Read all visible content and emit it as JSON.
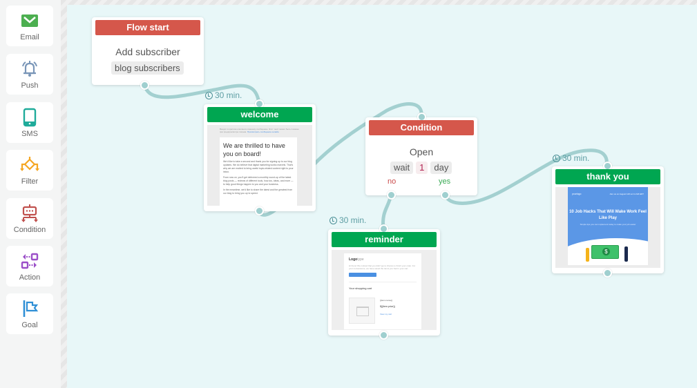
{
  "sidebar": {
    "items": [
      {
        "label": "Email",
        "icon": "envelope-icon",
        "color": "#4caf50"
      },
      {
        "label": "Push",
        "icon": "bell-icon",
        "color": "#7a96b8"
      },
      {
        "label": "SMS",
        "icon": "smartphone-icon",
        "color": "#1fab9a"
      },
      {
        "label": "Filter",
        "icon": "filter-branch-icon",
        "color": "#f5a623"
      },
      {
        "label": "Condition",
        "icon": "condition-robot-icon",
        "color": "#c0504d"
      },
      {
        "label": "Action",
        "icon": "action-arrows-icon",
        "color": "#9b4fc8"
      },
      {
        "label": "Goal",
        "icon": "flag-icon",
        "color": "#2f8fd6"
      }
    ]
  },
  "flow": {
    "start": {
      "header": "Flow start",
      "title": "Add subscriber",
      "tag": "blog subscribers"
    },
    "welcome": {
      "delay": "30 min.",
      "header": "welcome",
      "preview": {
        "top_note": "Вендит в кратком описании к вашему сообщению. Этот текст может быть показан при предпросмотре письма.",
        "top_link": "Просмотреть сообщение онлайн",
        "heading": "We are thrilled to have you on board!",
        "paragraphs": [
          "We'd like to take a second and thank you for signing up to our blog updates. We do believe that digital marketing works marvels. That's why we are excited to bring useful topic-related content right to your inbox.",
          "From now on, you'll get delivered a monthly round-up of the latest blog posts — reviews of different tools, how-tos, ideas, and more — to help good things happen to you and your business.",
          "In the meantime, we'd like to share the latest and the greatest from our blog to bring you up to speed."
        ]
      }
    },
    "condition": {
      "header": "Condition",
      "title": "Open",
      "wait_label": "wait",
      "wait_value": "1",
      "wait_unit": "day",
      "no_label": "no",
      "yes_label": "yes"
    },
    "reminder": {
      "delay": "30 min.",
      "header": "reminder",
      "preview": {
        "logo_bold": "Logo",
        "logo_light": "type",
        "text": "Hi there! We noticed that you didn't get a chance to finish your order. For your convenience, we have saved the items you had in your cart.",
        "button": "Complete your order",
        "cart_title": "Your shopping cart",
        "item_name": "{{item.name}}",
        "item_price": "${{item.price}}",
        "cart_link": "View my cart"
      }
    },
    "thankyou": {
      "delay": "30 min.",
      "header": "thank you",
      "preview": {
        "logo": "yourlogo",
        "date": "Join us on August 14th at 11 AM EDT",
        "heading": "10 Job Hacks That Will Make Work Feel Like Play",
        "sub": "Simple tips you can implement today to make your job easier"
      }
    }
  }
}
